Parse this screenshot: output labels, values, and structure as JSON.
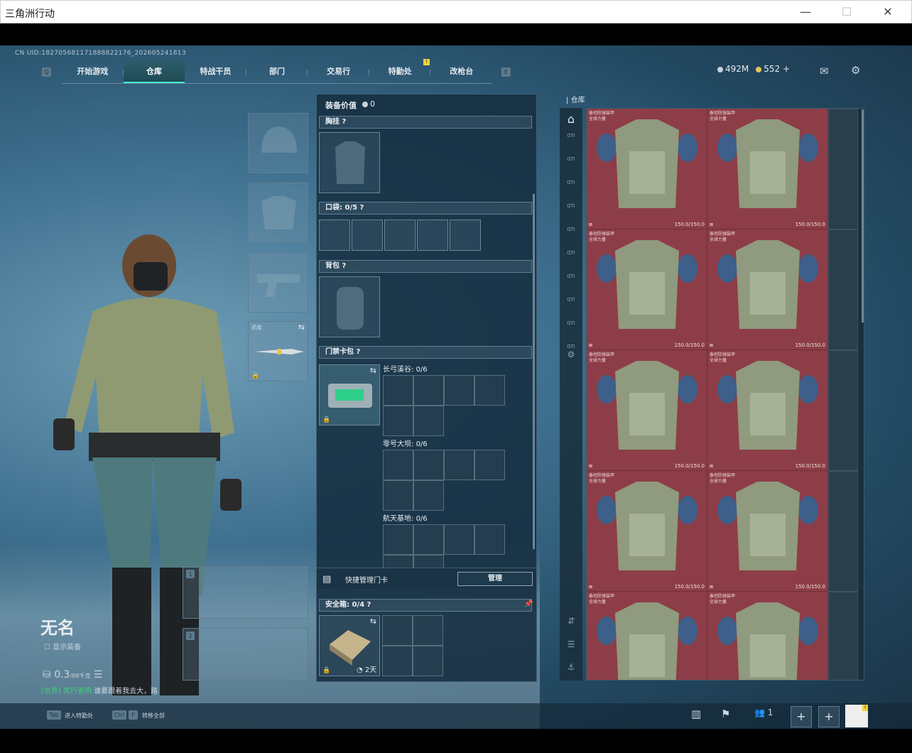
{
  "window": {
    "title": "三角洲行动"
  },
  "header": {
    "uid": "CN UID:182705681171888822176_202605241813",
    "tabs": [
      "开始游戏",
      "仓库",
      "特战干员",
      "部门",
      "交易行",
      "特勤处",
      "改枪台"
    ],
    "active_tab": "仓库",
    "key_left": "Q",
    "key_right": "E",
    "notif": "!",
    "currency": {
      "silver": "492M",
      "gold": "552",
      "plus": "+"
    }
  },
  "equip": {
    "value_label": "装备价值",
    "value": "0",
    "chest_rig": "胸挂",
    "pocket": "口袋:",
    "pocket_count": "0/5",
    "backpack": "背包",
    "keycard": "门禁卡包",
    "maps": [
      {
        "name": "长弓溪谷:",
        "count": "0/6"
      },
      {
        "name": "零号大坝:",
        "count": "0/6"
      },
      {
        "name": "航天基地:",
        "count": "0/6"
      }
    ],
    "quick_manage": "快捷管理门卡",
    "manage_btn": "管理",
    "safe_box": "安全箱:",
    "safe_count": "0/4",
    "days": "2天"
  },
  "warehouse": {
    "title": "仓库",
    "item_name_line1": "泰坦防弹装甲",
    "item_name_line2": "全球力量",
    "durability": "150.0/150.0",
    "side_tags": [
      "GTI",
      "GTI",
      "GTI",
      "GTI",
      "GTI",
      "GTI",
      "GTI",
      "GTI",
      "GTI",
      "GTI"
    ]
  },
  "character": {
    "name": "无名",
    "show_equip": "显示装备",
    "weight": "0.3",
    "weight_max": "/88千克",
    "melee_label": "近战",
    "slot1": "1",
    "slot2": "2"
  },
  "chat": {
    "channel": "[世界]",
    "user": "笑行者明",
    "text": "谁要跟着我去大，路"
  },
  "bottom": {
    "tab_key": "Tab",
    "tab_text": "进入特勤处",
    "ctrl_key": "Ctrl",
    "f_key": "F",
    "ctrl_text": "转移全部",
    "friends": "1"
  }
}
